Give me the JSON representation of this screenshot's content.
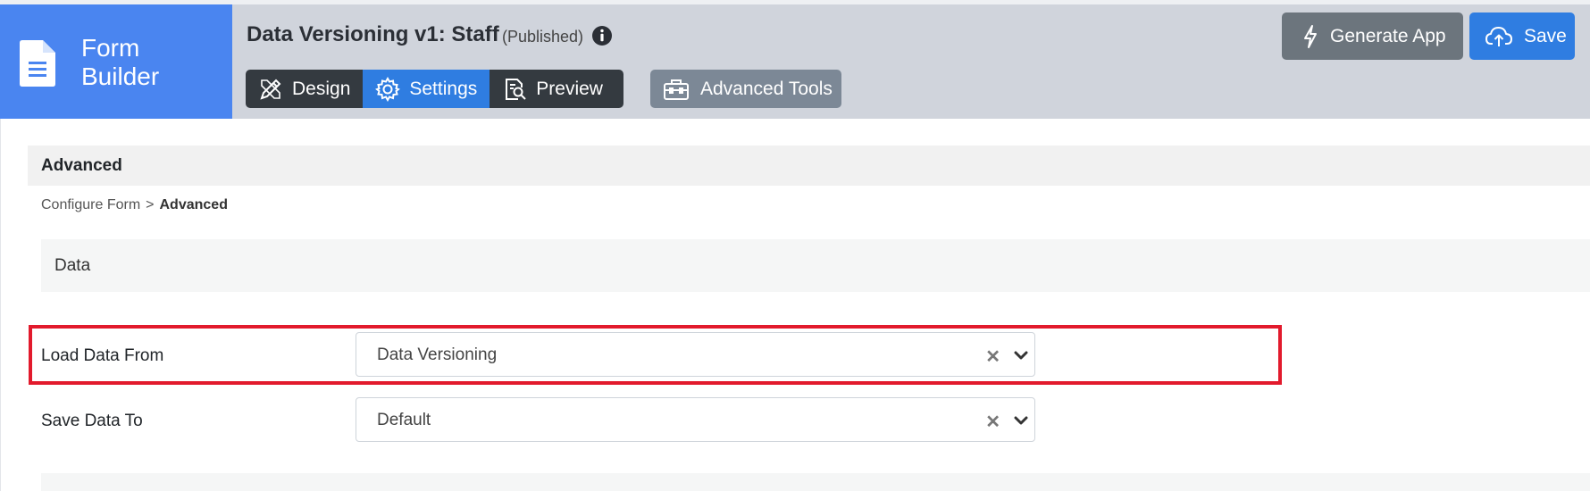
{
  "brand": {
    "line1": "Form",
    "line2": "Builder",
    "icon": "document-icon"
  },
  "form": {
    "title": "Data Versioning v1: Staff",
    "status": "(Published)",
    "info_icon": "info-circle-icon"
  },
  "tabs": [
    {
      "label": "Design",
      "icon": "pencil-ruler-icon",
      "active": false
    },
    {
      "label": "Settings",
      "icon": "gear-icon",
      "active": true
    },
    {
      "label": "Preview",
      "icon": "document-search-icon",
      "active": false
    }
  ],
  "advanced_tools": {
    "label": "Advanced Tools",
    "icon": "toolbox-icon"
  },
  "actions": {
    "generate_label": "Generate App",
    "generate_icon": "lightning-icon",
    "save_label": "Save",
    "save_icon": "cloud-upload-icon"
  },
  "section": {
    "title": "Advanced"
  },
  "breadcrumb": {
    "parent": "Configure Form",
    "separator": ">",
    "current": "Advanced"
  },
  "panel": {
    "title": "Data"
  },
  "fields": {
    "load": {
      "label": "Load Data From",
      "value": "Data Versioning"
    },
    "save": {
      "label": "Save Data To",
      "value": "Default"
    }
  },
  "colors": {
    "brand": "#4a85f0",
    "topbar": "#d0d4dc",
    "primary": "#2f7de1",
    "secondary": "#6c757d",
    "dark": "#343a40",
    "highlight": "#e21a2c"
  }
}
